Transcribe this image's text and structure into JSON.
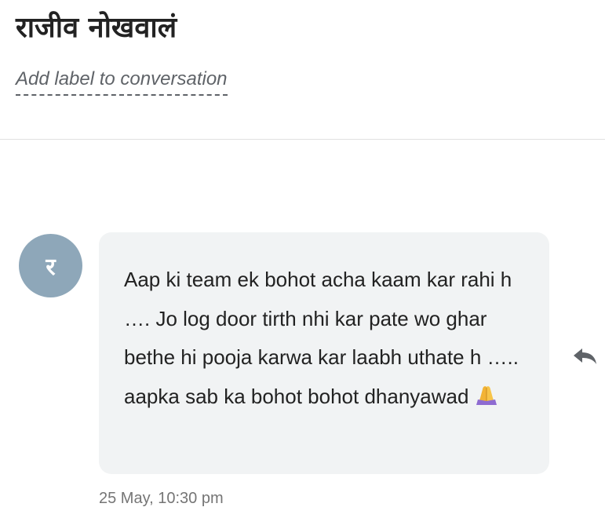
{
  "conversation": {
    "contact_name": "राजीव नोखवालं",
    "add_label_text": "Add label to conversation"
  },
  "message": {
    "avatar_letter": "र",
    "text": "Aap ki team ek bohot acha kaam kar rahi h …. Jo log door tirth nhi kar pate wo ghar bethe hi pooja karwa kar laabh uthate h ….. aapka sab ka bohot bohot dhanyawad",
    "emoji_icon": "folded-hands-icon",
    "timestamp": "25 May, 10:30 pm",
    "reply_icon": "reply-icon"
  },
  "colors": {
    "avatar_bg": "#8ea7b9",
    "bubble_bg": "#f1f3f4",
    "reply_icon": "#5f6368",
    "emoji": "#8e6bd1"
  }
}
